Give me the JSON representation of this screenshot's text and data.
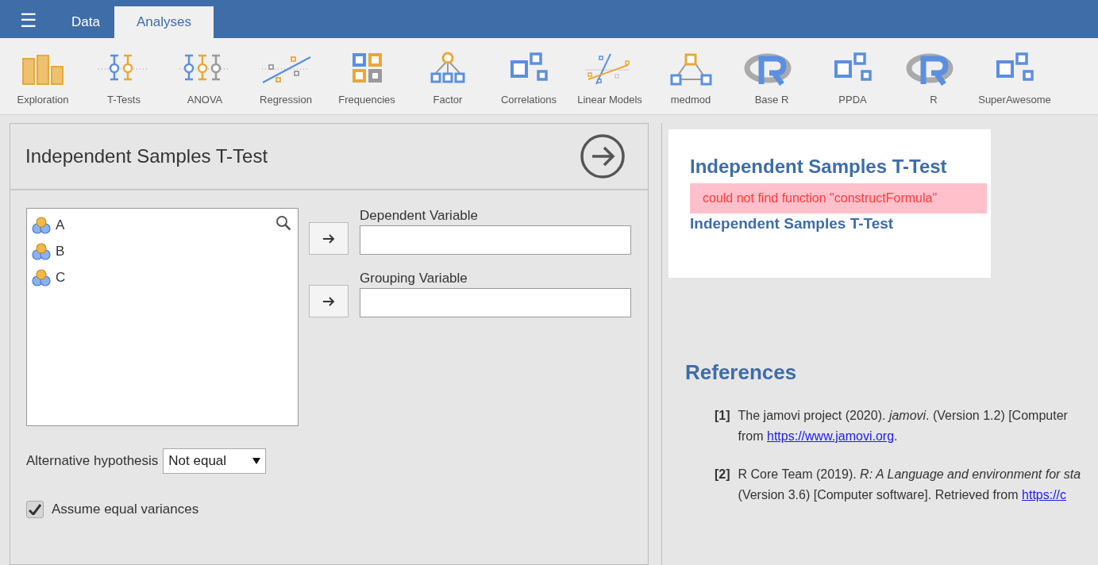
{
  "menu_button": "☰",
  "tabs": [
    {
      "label": "Data",
      "selected": false
    },
    {
      "label": "Analyses",
      "selected": true
    }
  ],
  "toolbar": [
    {
      "label": "Exploration",
      "kind": "bars"
    },
    {
      "label": "T-Tests",
      "kind": "ttest"
    },
    {
      "label": "ANOVA",
      "kind": "anova"
    },
    {
      "label": "Regression",
      "kind": "regression"
    },
    {
      "label": "Frequencies",
      "kind": "grid"
    },
    {
      "label": "Factor",
      "kind": "tree"
    },
    {
      "label": "Correlations",
      "kind": "squares"
    },
    {
      "label": "Linear Models",
      "kind": "linear"
    },
    {
      "label": "medmod",
      "kind": "triangle"
    },
    {
      "label": "Base R",
      "kind": "r"
    },
    {
      "label": "PPDA",
      "kind": "squares"
    },
    {
      "label": "R",
      "kind": "r"
    },
    {
      "label": "SuperAwesome",
      "kind": "squares"
    }
  ],
  "options_panel": {
    "title": "Independent Samples T-Test",
    "variables": [
      "A",
      "B",
      "C"
    ],
    "targets": [
      {
        "label": "Dependent Variable"
      },
      {
        "label": "Grouping Variable"
      }
    ],
    "alternative": {
      "label": "Alternative hypothesis",
      "value": "Not equal"
    },
    "equal_variances": {
      "label": "Assume equal variances",
      "checked": true
    }
  },
  "results": {
    "title": "Independent Samples T-Test",
    "error": "could not find function \"constructFormula\"",
    "subtitle": "Independent Samples T-Test",
    "references_title": "References",
    "references": [
      {
        "number": "[1]",
        "line_1": "The jamovi project (2020). *jamovi*. (Version 1.2) [Computer",
        "line_2_before": "from ",
        "link": "https://www.jamovi.org",
        "line_2_after": "."
      },
      {
        "number": "[2]",
        "line_1": "R Core Team (2019). *R: A Language and environment for sta*",
        "line_2_before": "(Version 3.6) [Computer software]. Retrieved from ",
        "link": "https://c"
      }
    ]
  }
}
